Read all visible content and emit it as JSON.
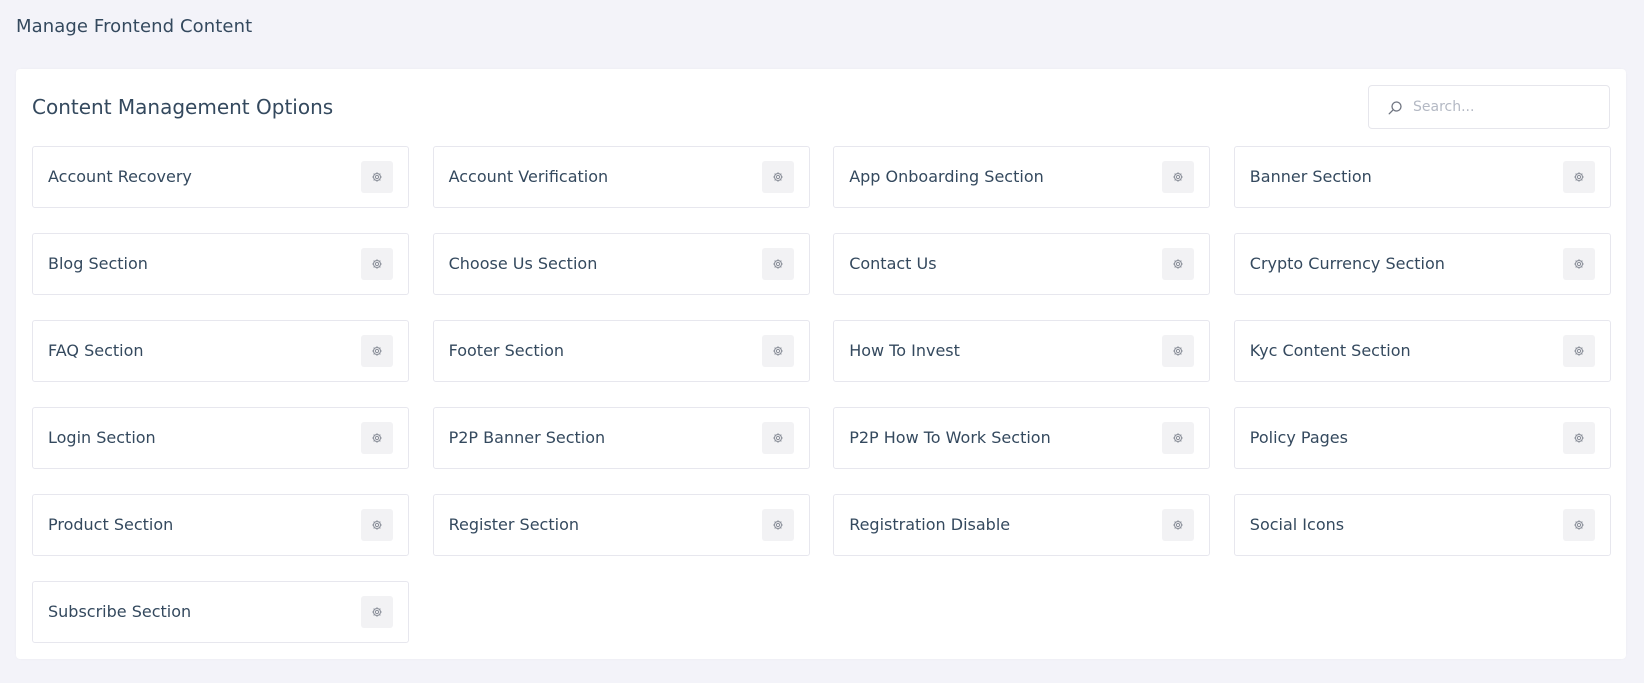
{
  "header": {
    "title": "Manage Frontend Content"
  },
  "card": {
    "title": "Content Management Options",
    "search": {
      "placeholder": "Search...",
      "value": ""
    }
  },
  "options": [
    {
      "label": "Account Recovery",
      "icon": "gear-icon"
    },
    {
      "label": "Account Verification",
      "icon": "gear-icon"
    },
    {
      "label": "App Onboarding Section",
      "icon": "gear-icon"
    },
    {
      "label": "Banner Section",
      "icon": "gear-icon"
    },
    {
      "label": "Blog Section",
      "icon": "gear-icon"
    },
    {
      "label": "Choose Us Section",
      "icon": "gear-icon"
    },
    {
      "label": "Contact Us",
      "icon": "gear-icon"
    },
    {
      "label": "Crypto Currency Section",
      "icon": "gear-icon"
    },
    {
      "label": "FAQ Section",
      "icon": "gear-icon"
    },
    {
      "label": "Footer Section",
      "icon": "gear-icon"
    },
    {
      "label": "How To Invest",
      "icon": "gear-icon"
    },
    {
      "label": "Kyc Content Section",
      "icon": "gear-icon"
    },
    {
      "label": "Login Section",
      "icon": "gear-icon"
    },
    {
      "label": "P2P Banner Section",
      "icon": "gear-icon"
    },
    {
      "label": "P2P How To Work Section",
      "icon": "gear-icon"
    },
    {
      "label": "Policy Pages",
      "icon": "gear-icon"
    },
    {
      "label": "Product Section",
      "icon": "gear-icon"
    },
    {
      "label": "Register Section",
      "icon": "gear-icon"
    },
    {
      "label": "Registration Disable",
      "icon": "gear-icon"
    },
    {
      "label": "Social Icons",
      "icon": "gear-icon"
    },
    {
      "label": "Subscribe Section",
      "icon": "gear-icon"
    }
  ],
  "colors": {
    "background": "#f3f3f9",
    "card": "#ffffff",
    "text": "#34495e",
    "border": "#e7e7ee",
    "icon_button": "#f2f2f4",
    "icon": "#8a8f99"
  }
}
